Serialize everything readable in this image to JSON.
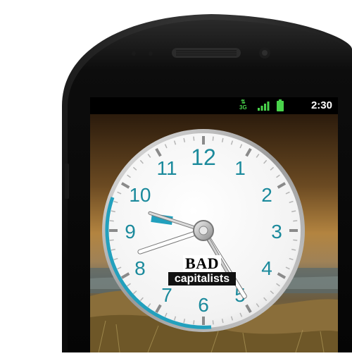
{
  "status_bar": {
    "network_type": "3G",
    "network_arrows": "⇅",
    "signal_icon": "signal-bars-icon",
    "battery_icon": "battery-full-icon",
    "time": "2:30",
    "accent": "#49d34b"
  },
  "clock_widget": {
    "numbers": [
      "12",
      "1",
      "2",
      "3",
      "4",
      "5",
      "6",
      "7",
      "8",
      "9",
      "10",
      "11"
    ],
    "number_color": "#1b8a9c",
    "accent": "#22a0bd",
    "hour_hand_time_hours": 8,
    "minute_hand_time_minutes": 23,
    "second_hand_time_seconds": 28
  },
  "brand": {
    "line1": "BAD",
    "line2": "capitalists"
  }
}
